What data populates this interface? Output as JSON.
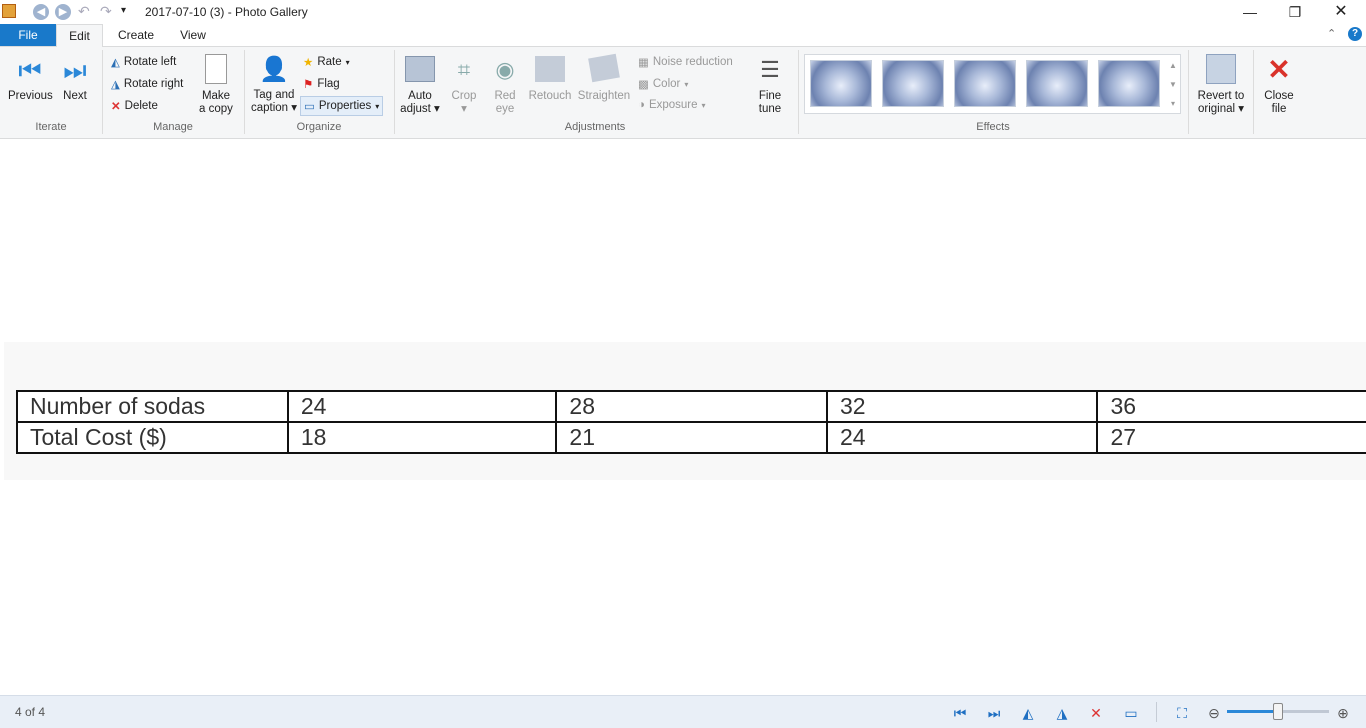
{
  "window": {
    "title": "2017-07-10 (3) - Photo Gallery"
  },
  "tabs": [
    {
      "label": "File"
    },
    {
      "label": "Edit"
    },
    {
      "label": "Create"
    },
    {
      "label": "View"
    }
  ],
  "ribbon": {
    "iterate": {
      "name": "Iterate",
      "previous": "Previous",
      "next": "Next"
    },
    "manage": {
      "name": "Manage",
      "rotate_left": "Rotate left",
      "rotate_right": "Rotate right",
      "delete": "Delete",
      "make_copy_1": "Make",
      "make_copy_2": "a copy"
    },
    "organize": {
      "name": "Organize",
      "tag_1": "Tag and",
      "tag_2": "caption",
      "rate": "Rate",
      "flag": "Flag",
      "properties": "Properties"
    },
    "adjustments": {
      "name": "Adjustments",
      "auto_1": "Auto",
      "auto_2": "adjust",
      "crop": "Crop",
      "red_1": "Red",
      "red_2": "eye",
      "retouch": "Retouch",
      "straighten": "Straighten",
      "noise": "Noise reduction",
      "color": "Color",
      "exposure": "Exposure",
      "fine_1": "Fine",
      "fine_2": "tune"
    },
    "effects": {
      "name": "Effects"
    },
    "revert_1": "Revert to",
    "revert_2": "original",
    "close_1": "Close",
    "close_2": "file"
  },
  "table": {
    "rows": [
      [
        "Number of sodas",
        "24",
        "28",
        "32",
        "36"
      ],
      [
        "Total Cost ($)",
        "18",
        "21",
        "24",
        "27"
      ]
    ]
  },
  "status": {
    "position": "4 of 4",
    "zoom_fraction": 0.5
  }
}
